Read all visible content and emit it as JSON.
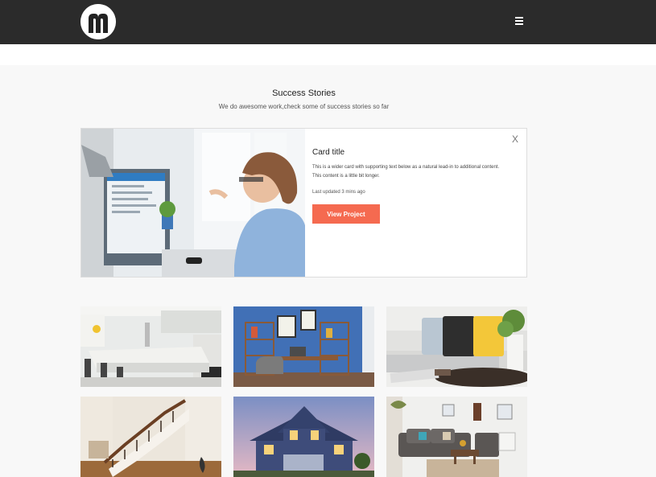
{
  "header": {
    "logo_icon": "m-logo-icon",
    "menu_icon": "hamburger-menu-icon"
  },
  "section": {
    "title": "Success Stories",
    "subtitle": "We do awesome work,check some of success stories so far"
  },
  "card": {
    "close_label": "X",
    "title": "Card title",
    "text": "This is a wider card with supporting text below as a natural lead-in to additional content. This content is a little bit longer.",
    "updated": "Last updated 3 mins ago",
    "button_label": "View Project",
    "button_color": "#f56a50"
  },
  "gallery": {
    "items": [
      {
        "icon": "kitchen-photo"
      },
      {
        "icon": "home-office-photo"
      },
      {
        "icon": "living-room-sofa-photo"
      },
      {
        "icon": "staircase-photo"
      },
      {
        "icon": "house-exterior-photo"
      },
      {
        "icon": "lounge-photo"
      }
    ]
  },
  "colors": {
    "topbar": "#2b2b2b",
    "page_background": "#f8f8f8",
    "accent": "#f56a50"
  }
}
